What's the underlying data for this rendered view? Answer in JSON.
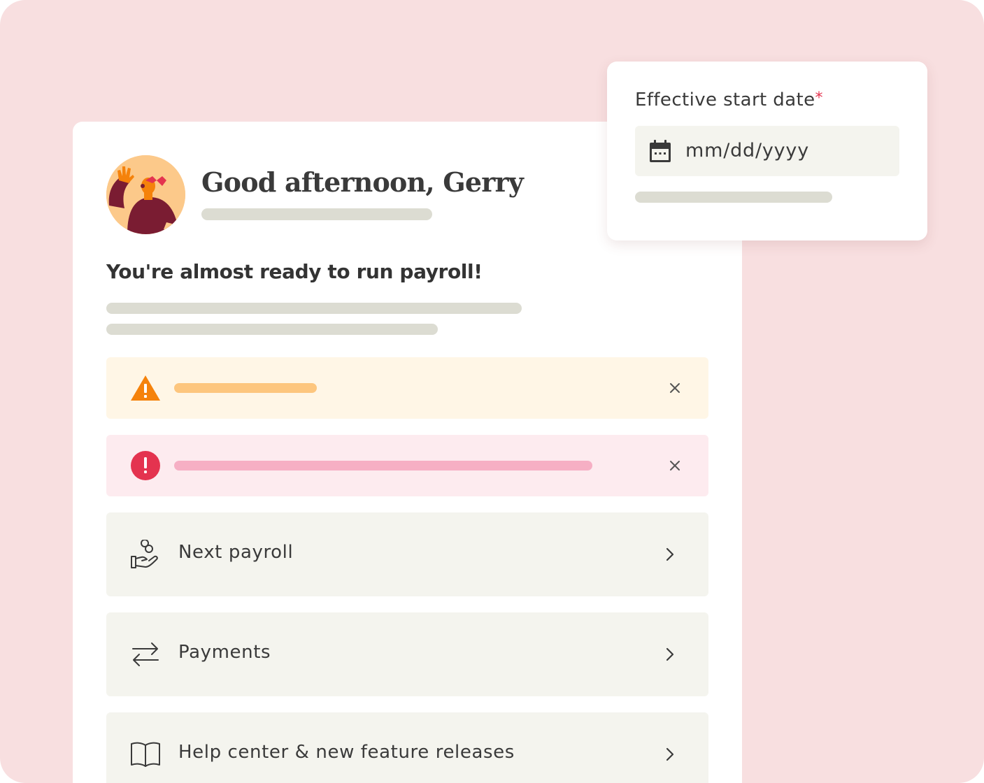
{
  "greeting": {
    "title": "Good afternoon, Gerry"
  },
  "onboarding": {
    "headline": "You're almost ready to run payroll!"
  },
  "alerts": [
    {
      "type": "warning",
      "icon": "warning-triangle-icon",
      "color": "#f5820b",
      "dismiss_icon": "close-icon"
    },
    {
      "type": "error",
      "icon": "exclamation-circle-icon",
      "color": "#e4334f",
      "dismiss_icon": "close-icon"
    }
  ],
  "nav_items": [
    {
      "label": "Next payroll",
      "icon": "hand-coins-icon"
    },
    {
      "label": "Payments",
      "icon": "transfer-arrows-icon"
    },
    {
      "label": "Help center & new feature releases",
      "icon": "open-book-icon"
    }
  ],
  "date_field": {
    "label": "Effective start date",
    "required_marker": "*",
    "placeholder": "mm/dd/yyyy",
    "icon": "calendar-icon"
  },
  "colors": {
    "background": "#f8dfe0",
    "avatar_background": "#fcc98a",
    "warning_bg": "#fff6e6",
    "error_bg": "#fdebef",
    "required": "#e4334f"
  }
}
